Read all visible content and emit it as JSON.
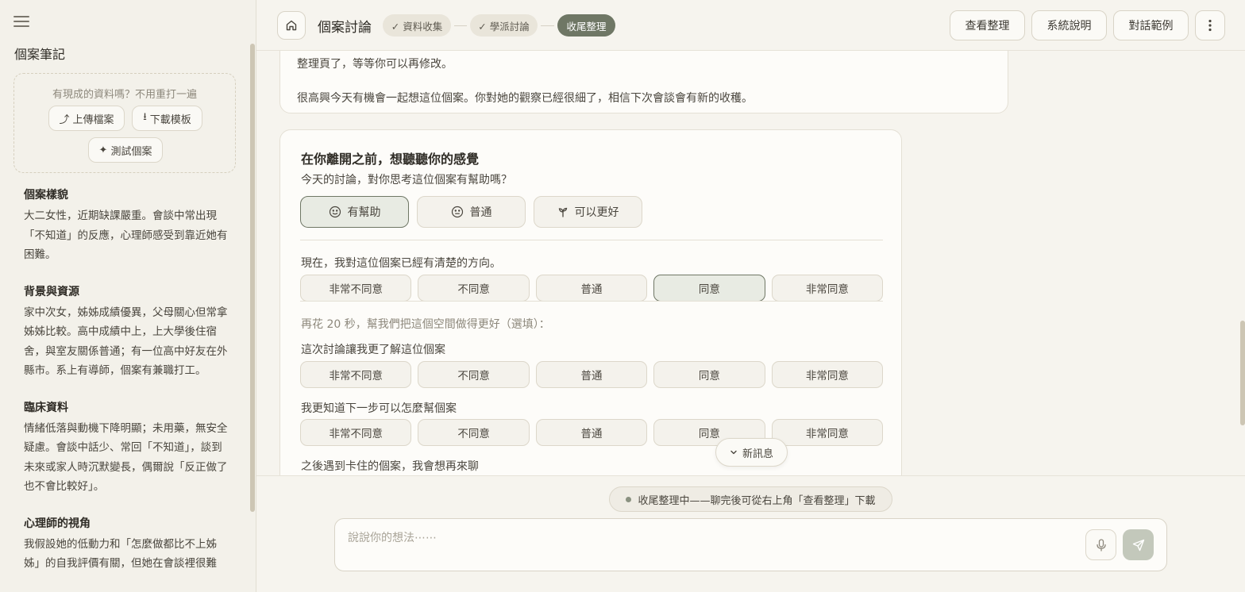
{
  "sidebar": {
    "menu_icon": "menu-icon",
    "title": "個案筆記",
    "upload_hint": "有現成的資料嗎？不用重打一遍",
    "upload_label": "上傳檔案",
    "download_label": "下載模板",
    "test_label": "測試個案",
    "sections": [
      {
        "heading": "個案樣貌",
        "body": "大二女性，近期缺課嚴重。會談中常出現「不知道」的反應，心理師感受到靠近她有困難。"
      },
      {
        "heading": "背景與資源",
        "body": "家中次女，姊姊成績優異，父母關心但常拿姊姊比較。高中成績中上，上大學後住宿舍，與室友關係普通；有一位高中好友在外縣市。系上有導師，個案有兼職打工。"
      },
      {
        "heading": "臨床資料",
        "body": "情緒低落與動機下降明顯；未用藥，無安全疑慮。會談中話少、常回「不知道」，談到未來或家人時沉默變長，偶爾說「反正做了也不會比較好」。"
      },
      {
        "heading": "心理師的視角",
        "body": "我假設她的低動力和「怎麼做都比不上姊姊」的自我評價有關，但她在會談裡很難"
      }
    ]
  },
  "header": {
    "title": "個案討論",
    "stages": [
      {
        "label": "✓ 資料收集",
        "state": "done"
      },
      {
        "label": "✓ 學派討論",
        "state": "done"
      },
      {
        "label": "收尾整理",
        "state": "active"
      }
    ],
    "view_summary": "查看整理",
    "system_info": "系統說明",
    "examples": "對話範例"
  },
  "chat": {
    "message_paragraphs": [
      "整理頁了，等等你可以再修改。",
      "很高興今天有機會一起想這位個案。你對她的觀察已經很細了，相信下次會談會有新的收穫。"
    ],
    "feedback": {
      "title": "在你離開之前，想聽聽你的感覺",
      "subtitle": "今天的討論，對你思考這位個案有幫助嗎？",
      "ratings": [
        {
          "label": "有幫助",
          "icon": "smile-icon",
          "selected": true
        },
        {
          "label": "普通",
          "icon": "neutral-face-icon",
          "selected": false
        },
        {
          "label": "可以更好",
          "icon": "sprout-icon",
          "selected": false
        }
      ],
      "likert_options": [
        "非常不同意",
        "不同意",
        "普通",
        "同意",
        "非常同意"
      ],
      "q1": {
        "text": "現在，我對這位個案已經有清楚的方向。",
        "selected": "同意"
      },
      "optional_hint": "再花 20 秒，幫我們把這個空間做得更好（選填）：",
      "q2": {
        "text": "這次討論讓我更了解這位個案"
      },
      "q3": {
        "text": "我更知道下一步可以怎麼幫個案"
      },
      "q4": {
        "text": "之後遇到卡住的個案，我會想再來聊"
      }
    },
    "new_message_label": "新訊息"
  },
  "bottom": {
    "status": "收尾整理中——聊完後可從右上角「查看整理」下載",
    "input_placeholder": "說說你的想法⋯⋯",
    "input_value": ""
  },
  "colors": {
    "accent": "#6f7765",
    "background": "#f6f4ee",
    "card": "#fdfcf9"
  }
}
